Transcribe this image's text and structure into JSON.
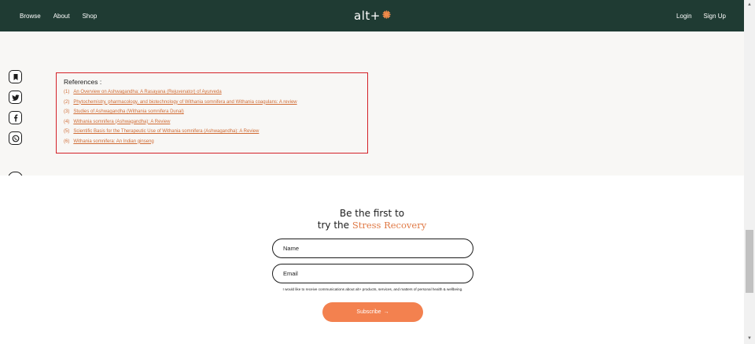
{
  "nav": {
    "links_left": [
      "Browse",
      "About",
      "Shop"
    ],
    "logo_text": "alt+",
    "logo_icon": "sunburst-icon",
    "links_right": [
      "Login",
      "Sign Up"
    ],
    "background": "#1f3b33"
  },
  "sidebar": {
    "icons": [
      "bookmark-icon",
      "twitter-icon",
      "facebook-icon",
      "whatsapp-icon"
    ],
    "back_icon": "arrow-left-icon"
  },
  "references": {
    "title": "References :",
    "items": [
      {
        "num": "(1)",
        "text": "An Overview on Ashwagandha: A Rasayana (Rejuvenator) of Ayurveda"
      },
      {
        "num": "(2)",
        "text": "Phytochemistry, pharmacology, and biotechnology of Withania somnifera and Withania coagulans: A review"
      },
      {
        "num": "(3)",
        "text": "Studies of Ashwagandha (Withania somnifera Dunal)"
      },
      {
        "num": "(4)",
        "text": "Withania somnifera (Ashwagandha): A Review"
      },
      {
        "num": "(5)",
        "text": "Scientific Basis for the Therapeutic Use of Withania somnifera (Ashwagandha): A Review"
      },
      {
        "num": "(6)",
        "text": "Withania somnifera: An Indian ginseng"
      }
    ],
    "highlight_color": "#d42128",
    "link_color": "#d06c35"
  },
  "signup": {
    "heading_line1": "Be the first to",
    "heading_line2_prefix": "try the ",
    "heading_line2_accent": "Stress Recovery",
    "name_placeholder": "Name",
    "email_placeholder": "Email",
    "consent": "I would like to receive communications about alt+ products, services, and matters of personal health & wellbeing.",
    "button_label": "Subscribe",
    "button_arrow": "→",
    "accent_color": "#f3814f"
  }
}
